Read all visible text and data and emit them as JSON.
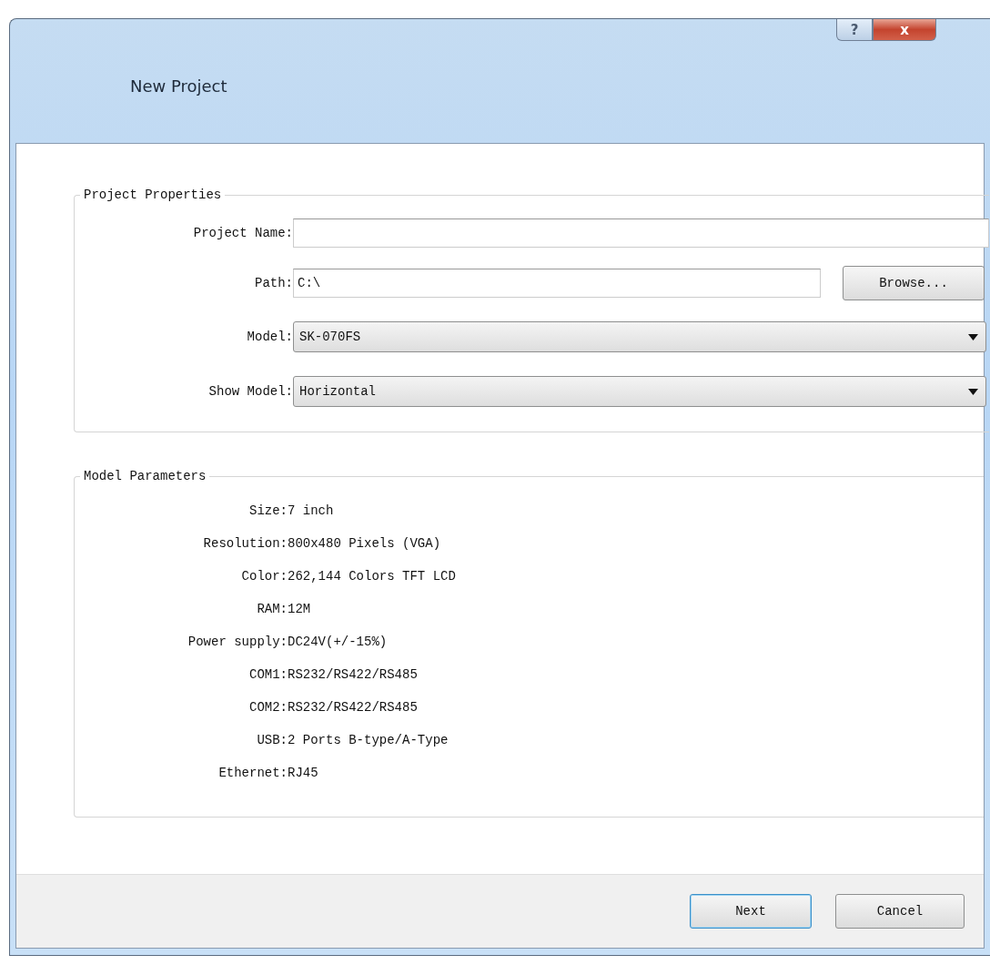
{
  "window": {
    "title": "New Project",
    "controls": [
      "?",
      "x"
    ]
  },
  "project_properties": {
    "title": "Project Properties",
    "fields": [
      {
        "kind": "text",
        "label": "Project Name:"
      },
      {
        "kind": "text_with_button",
        "label": "Path:",
        "value": "C:\\",
        "button": "Browse..."
      },
      {
        "kind": "dropdown",
        "label": "Model:",
        "value": "SK-070FS"
      },
      {
        "kind": "dropdown",
        "label": "Show Model:",
        "value": "Horizontal"
      }
    ]
  },
  "model_parameters": {
    "title": "Model Parameters",
    "rows": [
      {
        "label": "Size:",
        "value": "7 inch"
      },
      {
        "label": "Resolution:",
        "value": "800x480 Pixels (VGA)"
      },
      {
        "label": "Color:",
        "value": "262,144 Colors TFT LCD"
      },
      {
        "label": "RAM:",
        "value": "12M"
      },
      {
        "label": "Power supply:",
        "value": "DC24V(+/-15%)"
      },
      {
        "label": "COM1:",
        "value": "RS232/RS422/RS485"
      },
      {
        "label": "COM2:",
        "value": "RS232/RS422/RS485"
      },
      {
        "label": "USB:",
        "value": "2 Ports B-type/A-Type"
      },
      {
        "label": "Ethernet:",
        "value": "RJ45"
      }
    ]
  },
  "buttons": [
    {
      "label": "Next",
      "default": true
    },
    {
      "label": "Cancel",
      "default": false
    }
  ]
}
